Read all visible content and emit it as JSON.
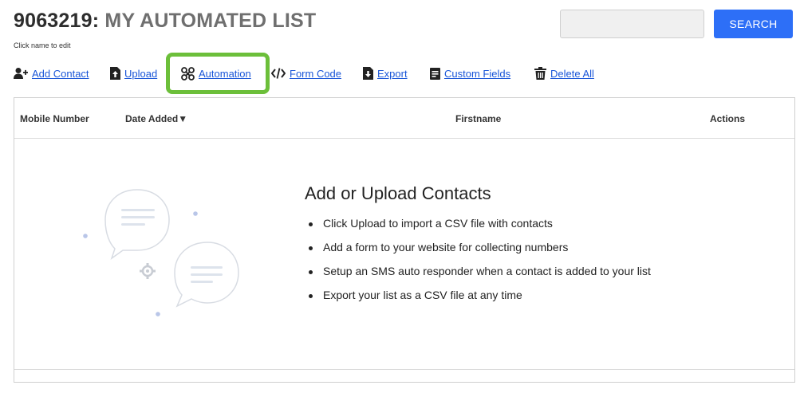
{
  "header": {
    "list_id": "9063219:",
    "list_name": "MY AUTOMATED LIST",
    "subtitle": "Click name to edit"
  },
  "search": {
    "value": "",
    "button_label": "SEARCH"
  },
  "toolbar": {
    "items": [
      {
        "label": "Add Contact",
        "icon": "add-user-icon"
      },
      {
        "label": "Upload",
        "icon": "upload-file-icon"
      },
      {
        "label": "Automation",
        "icon": "automation-icon"
      },
      {
        "label": "Form Code",
        "icon": "code-icon"
      },
      {
        "label": "Export",
        "icon": "export-file-icon"
      },
      {
        "label": "Custom Fields",
        "icon": "custom-fields-icon"
      },
      {
        "label": "Delete All",
        "icon": "trash-icon"
      }
    ],
    "highlighted": "Automation"
  },
  "table": {
    "columns": [
      "Mobile Number",
      "Date Added▼",
      "Firstname",
      "Actions"
    ]
  },
  "empty_state": {
    "title": "Add or Upload Contacts",
    "bullets": [
      "Click Upload to import a CSV file with contacts",
      "Add a form to your website for collecting numbers",
      "Setup an SMS auto responder when a contact is added to your list",
      "Export your list as a CSV file at any time"
    ]
  },
  "colors": {
    "accent": "#2d6ff7",
    "link": "#1a56d8",
    "highlight": "#6cbf3a"
  }
}
